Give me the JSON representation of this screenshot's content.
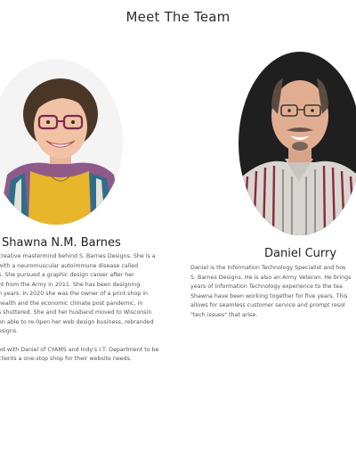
{
  "page": {
    "title": "Meet The Team"
  },
  "members": [
    {
      "name": "Shawna N.M. Barnes",
      "photo_icon": "portrait-photo",
      "bio_paragraph_1": "creative mastermind behind S. Barnes Designs. She is a\n with a neuromuscular autoimmune disease called\ns. She pursued a graphic design career after her\nnt from the Army in 2011. She has been designing\nn years. In 2020 she was the owner of a print shop in\n health and the economic climate post pandemic, in\ns shuttered. She and her husband moved to Wisconsin\nen able to re-0pen her web design business, rebranded\nesigns.",
      "bio_paragraph_2": "ed with Daniel of CYAMS and Indy's I.T. Department to be\n clients a one-stop shop for their website needs."
    },
    {
      "name": "Daniel Curry",
      "photo_icon": "portrait-photo",
      "bio_paragraph_1": "Daniel is the Information Technology Specialist and hos\nS. Barnes Designs. He is also an Army Veteran. He brings\nyears of Information Technology experience to the tea\nShawna have been working together for five years. This\nallows for seamless customer service and prompt resol\n\"tech issues\" that arise."
    }
  ],
  "colors": {
    "background": "#ffffff",
    "heading": "#2b2b2b",
    "body_text": "#555555"
  }
}
